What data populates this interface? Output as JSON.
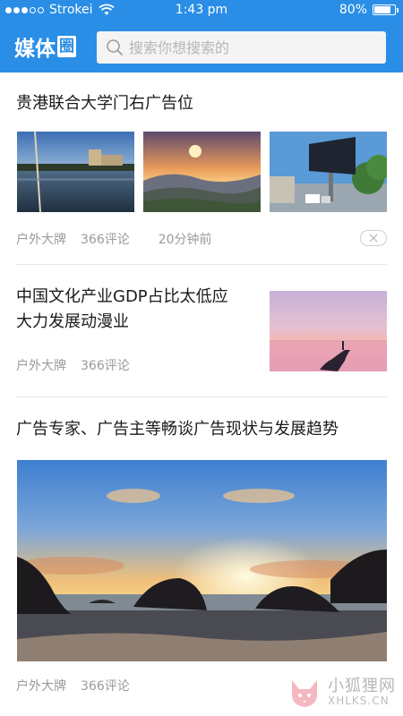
{
  "status_bar": {
    "carrier": "Strokei",
    "time": "1:43 pm",
    "battery": "80%",
    "battery_level": 0.8
  },
  "header": {
    "logo_text_main": "媒体",
    "logo_text_box": "圈",
    "search_placeholder": "搜索你想搜索的"
  },
  "articles": [
    {
      "title": "贵港联合大学门右广告位",
      "source": "户外大牌",
      "comments": "366评论",
      "time": "20分钟前"
    },
    {
      "title_line1": "中国文化产业GDP占比太低应",
      "title_line2": "大力发展动漫业",
      "source": "户外大牌",
      "comments": "366评论"
    },
    {
      "title": "广告专家、广告主等畅谈广告现状与发展趋势",
      "source": "户外大牌",
      "comments": "366评论"
    }
  ],
  "watermark": {
    "cn": "小狐狸网",
    "en": "XHLKS.CN"
  },
  "colors": {
    "brand": "#2a8ee6",
    "meta_text": "#9a9a9a",
    "divider": "#e6e6e6"
  }
}
